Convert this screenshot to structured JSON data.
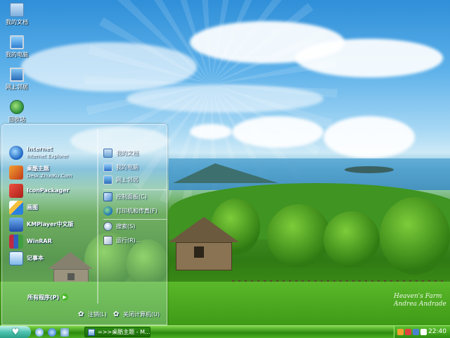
{
  "desktop": {
    "icons": [
      {
        "label": "我的文档",
        "icon": "folder-icon"
      },
      {
        "label": "我的电脑",
        "icon": "computer-icon"
      },
      {
        "label": "网上邻居",
        "icon": "network-icon"
      },
      {
        "label": "回收站",
        "icon": "recycle-bin-icon"
      }
    ],
    "watermark": {
      "line1": "Heaven's Farm",
      "line2": "Andrea Andrade"
    }
  },
  "start_menu": {
    "left_items": [
      {
        "title": "Internet",
        "subtitle": "Internet Explorer",
        "icon": "internet-explorer-icon"
      },
      {
        "title": "桌酷主题",
        "subtitle": "Desk.ZhuoKu.Com",
        "icon": "zhuoku-icon"
      },
      {
        "title": "IconPackager",
        "subtitle": "",
        "icon": "iconpackager-icon"
      },
      {
        "title": "画图",
        "subtitle": "",
        "icon": "paint-icon"
      },
      {
        "title": "KMPlayer中文版",
        "subtitle": "",
        "icon": "kmplayer-icon"
      },
      {
        "title": "WinRAR",
        "subtitle": "",
        "icon": "winrar-icon"
      },
      {
        "title": "记事本",
        "subtitle": "",
        "icon": "notepad-icon"
      }
    ],
    "all_programs": "所有程序(P)",
    "right_items": [
      {
        "label": "我的文档",
        "icon": "documents-icon"
      },
      {
        "label": "我的电脑",
        "icon": "computer-icon"
      },
      {
        "label": "网上邻居",
        "icon": "network-icon"
      },
      {
        "label": "控制面板(C)",
        "icon": "control-panel-icon"
      },
      {
        "label": "打印机和传真(F)",
        "icon": "printer-icon"
      },
      {
        "label": "搜索(S)",
        "icon": "search-icon"
      },
      {
        "label": "运行(R)...",
        "icon": "run-icon"
      }
    ],
    "logoff": "注销(L)",
    "shutdown": "关闭计算机(U)"
  },
  "taskbar": {
    "start_glyph": "♥",
    "task_label": "=>>桌酷主题 - M...",
    "clock": "22:40"
  }
}
